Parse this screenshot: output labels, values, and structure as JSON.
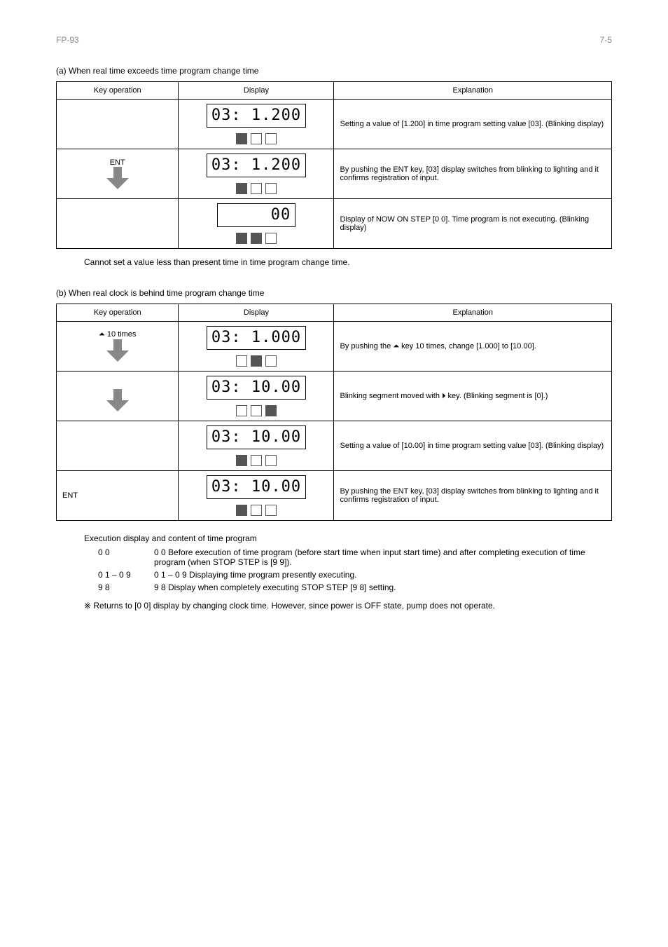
{
  "header": {
    "left": "FP-93",
    "right": "7-5"
  },
  "section_a": {
    "title": "(a)  When real time exceeds time program change time",
    "table": {
      "headers": [
        "Key operation",
        "Display",
        "Explanation"
      ],
      "rows": [
        {
          "key": "",
          "display": "03: 1.200",
          "boxes": [
            true,
            false,
            false
          ],
          "arrow": false,
          "explanation": "Setting a value of [1.200] in time program setting value [03]. (Blinking display)"
        },
        {
          "key": "ENT",
          "display": "03: 1.200",
          "boxes": [
            true,
            false,
            false
          ],
          "arrow": true,
          "explanation": "By pushing the ENT key, [03] display switches from blinking to lighting and it confirms registration of input."
        },
        {
          "key": "",
          "display": "00",
          "boxes": [
            true,
            true,
            false
          ],
          "arrow": false,
          "explanation": "Display of NOW ON STEP [0 0]. Time program is not executing. (Blinking display)"
        }
      ]
    }
  },
  "section_b": {
    "title": "(b)  When real clock is behind time program change time",
    "table": {
      "headers": [
        "Key operation",
        "Display",
        "Explanation"
      ],
      "rows": [
        {
          "key": "⏶ 10 times",
          "display": "03: 1.000",
          "boxes": [
            false,
            true,
            false
          ],
          "arrow": true,
          "explanation": "By pushing the ⏶ key 10 times, change [1.000] to [10.00]."
        },
        {
          "key": "",
          "display": "03: 10.00",
          "boxes": [
            false,
            false,
            true
          ],
          "arrow": true,
          "explanation": "Blinking segment moved with ⏵ key. (Blinking segment is [0].)"
        },
        {
          "key": "",
          "display": "03: 10.00",
          "boxes": [
            true,
            false,
            false
          ],
          "arrow": false,
          "explanation": "Setting a value of [10.00] in time program setting value [03]. (Blinking display)"
        },
        {
          "key": "ENT",
          "display": "03: 10.00",
          "boxes": [
            true,
            false,
            false
          ],
          "arrow": false,
          "explanation": "By pushing the ENT key, [03] display switches from blinking to lighting and it confirms registration of input."
        }
      ]
    }
  },
  "note1": "Cannot set a value less than present time in time program change time.",
  "note2_title": "Execution display and content of time program",
  "note2_items": [
    "0 0 Before execution of time program (before start time when input start time) and after completing execution of time program (when STOP STEP is [9 9]).",
    "0 1 – 0 9 Displaying time program presently executing.",
    "9 8 Display when completely executing STOP STEP [9 8] setting.",
    "Returns to [0 0] display by changing clock time. However, since power is OFF state, pump does not operate."
  ]
}
